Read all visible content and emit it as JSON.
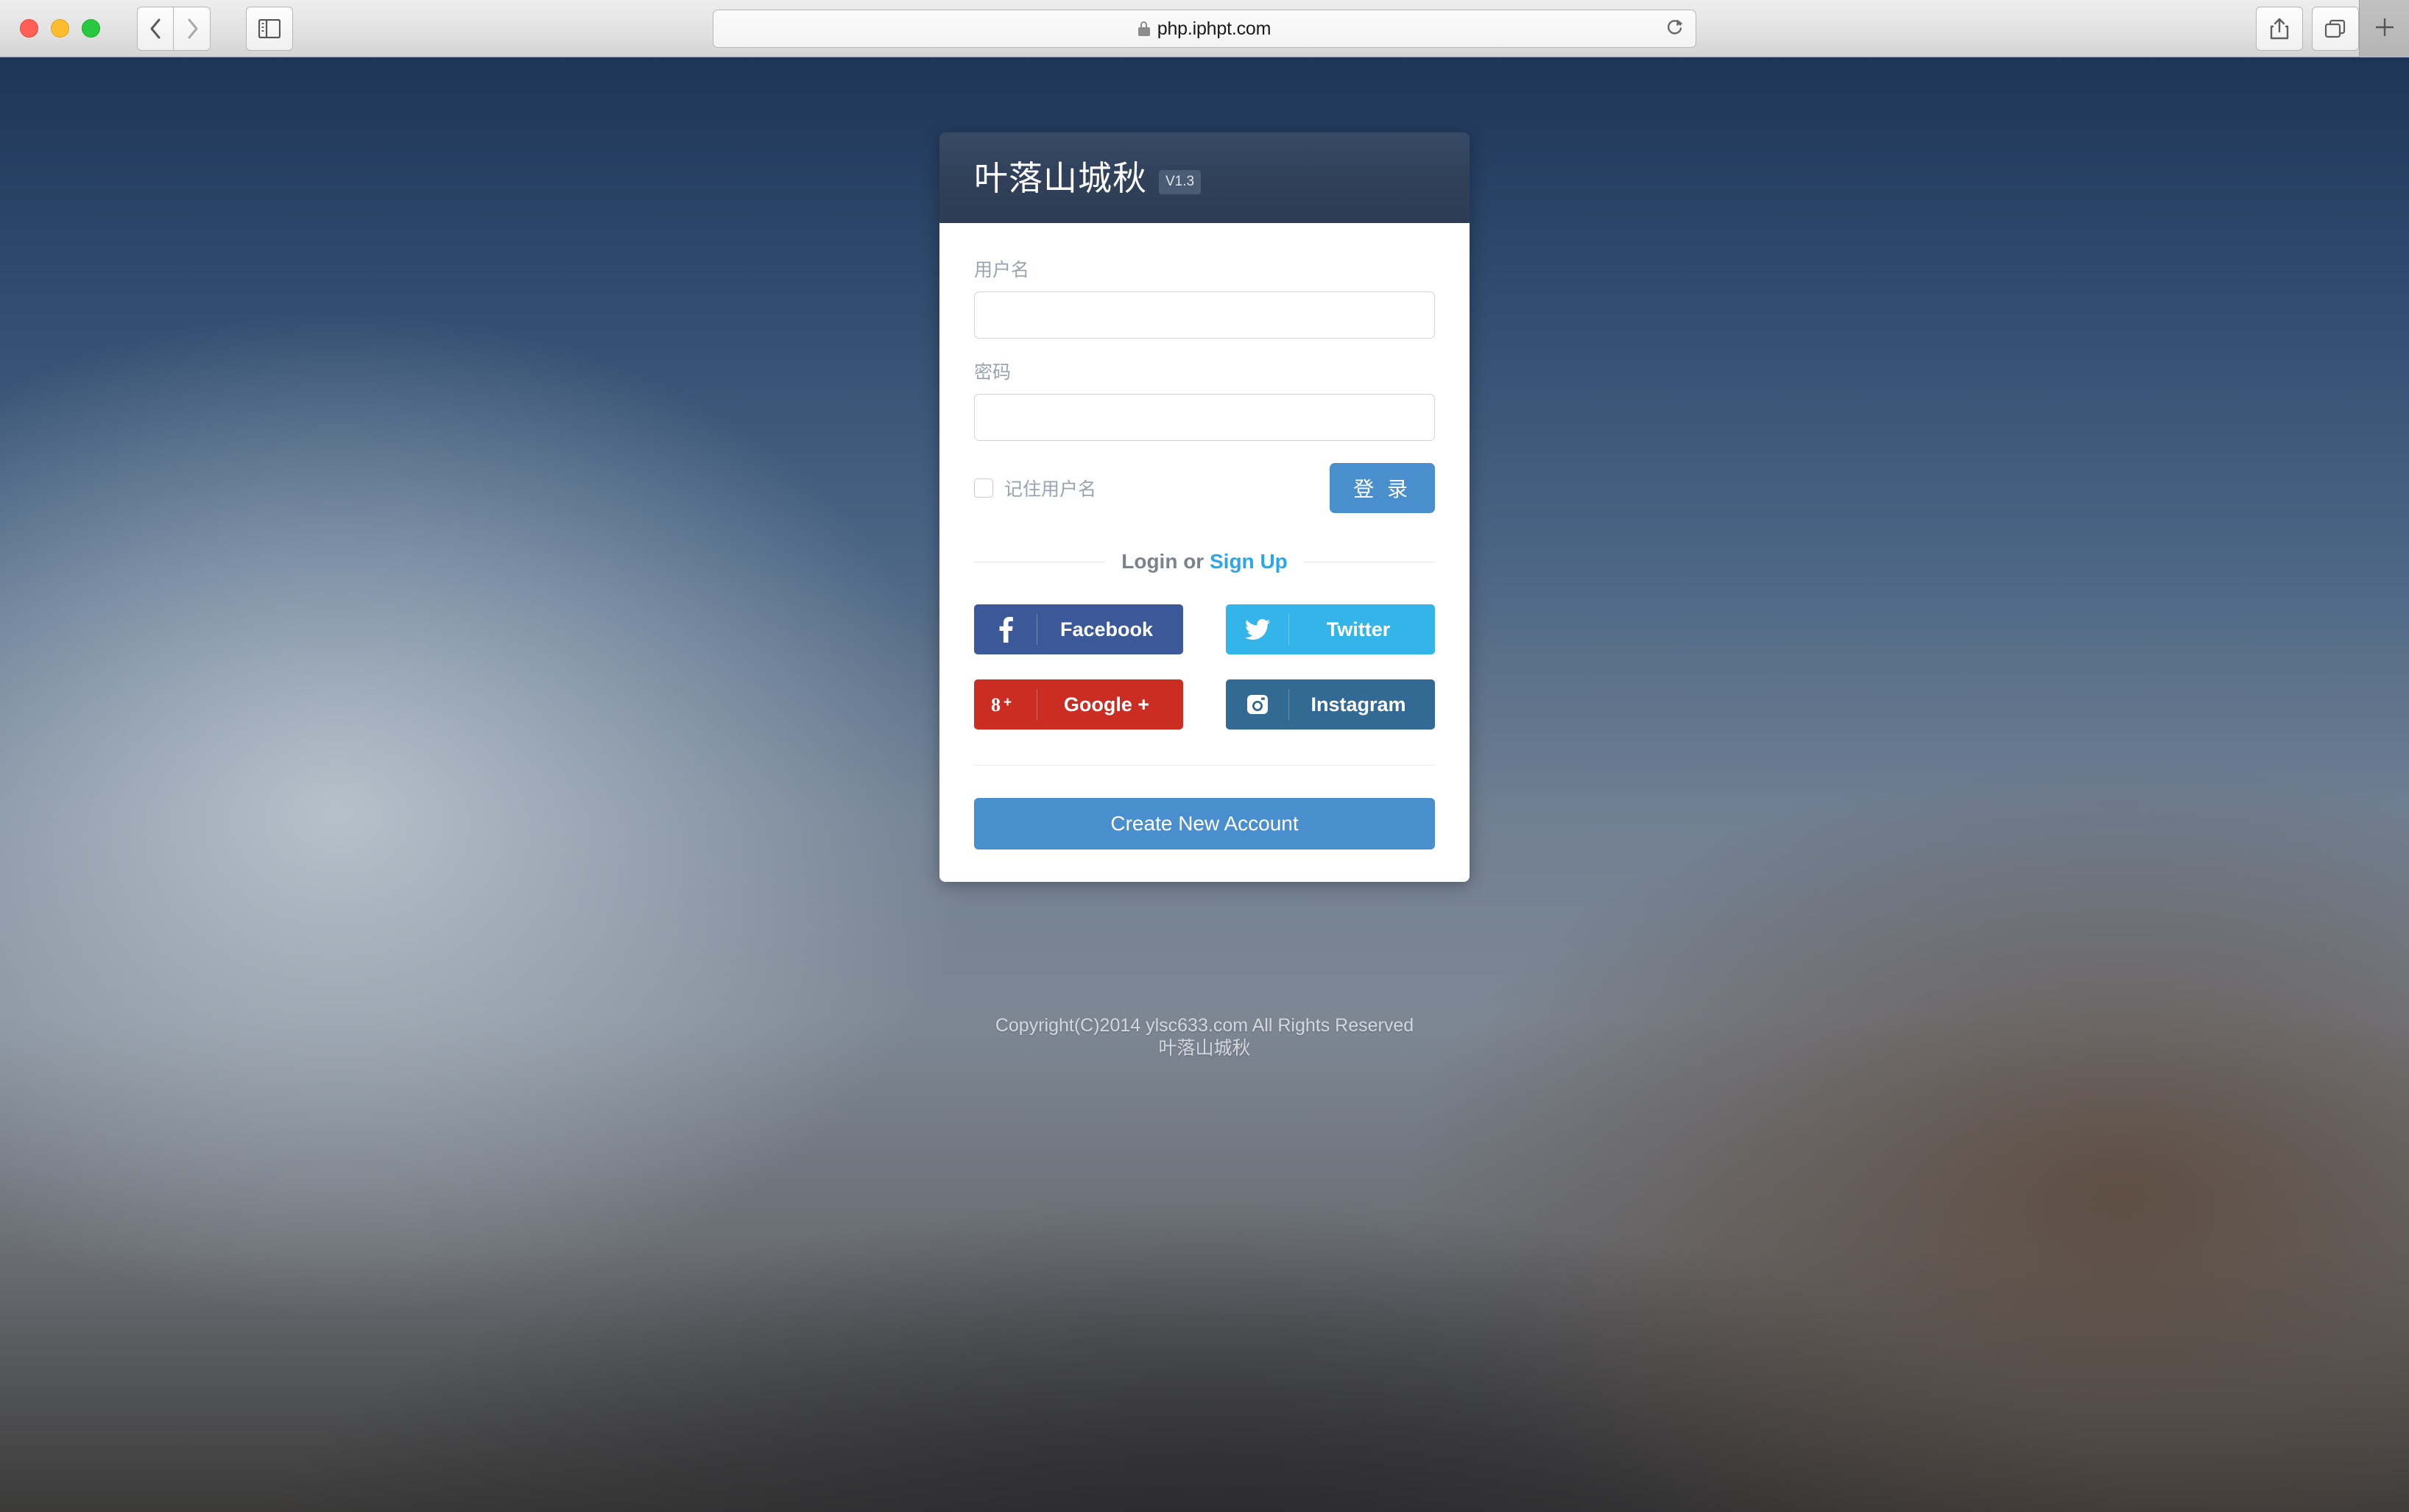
{
  "browser": {
    "url": "php.iphpt.com",
    "traffic_lights": [
      "close",
      "minimize",
      "maximize"
    ],
    "icons": {
      "back": "chevron-left-icon",
      "forward": "chevron-right-icon",
      "sidebar": "sidebar-toggle-icon",
      "lock": "lock-icon",
      "reload": "reload-icon",
      "share": "share-icon",
      "tabs": "show-all-tabs-icon",
      "newtab": "plus-icon"
    },
    "newtab_label": "+"
  },
  "card": {
    "title": "叶落山城秋",
    "version": "V1.3",
    "username": {
      "label": "用户名",
      "value": "",
      "placeholder": ""
    },
    "password": {
      "label": "密码",
      "value": "",
      "placeholder": ""
    },
    "remember": {
      "label": "记住用户名",
      "checked": false
    },
    "login_button": "登 录",
    "divider": {
      "prefix": "Login or ",
      "signup": "Sign Up"
    },
    "social": [
      {
        "name": "facebook",
        "label": "Facebook",
        "icon": "facebook-icon",
        "color": "#3b5998"
      },
      {
        "name": "twitter",
        "label": "Twitter",
        "icon": "twitter-icon",
        "color": "#33b5e9"
      },
      {
        "name": "googleplus",
        "label": "Google +",
        "icon": "googleplus-icon",
        "color": "#cb2d23"
      },
      {
        "name": "instagram",
        "label": "Instagram",
        "icon": "instagram-icon",
        "color": "#336a94"
      }
    ],
    "create_account_button": "Create New Account"
  },
  "footer": {
    "line1": "Copyright(C)2014 ylsc633.com All Rights Reserved",
    "line2": "叶落山城秋"
  },
  "colors": {
    "accent_blue": "#4a8fcd",
    "link_blue": "#2aa7e8",
    "header_navy": "#2f4058"
  }
}
